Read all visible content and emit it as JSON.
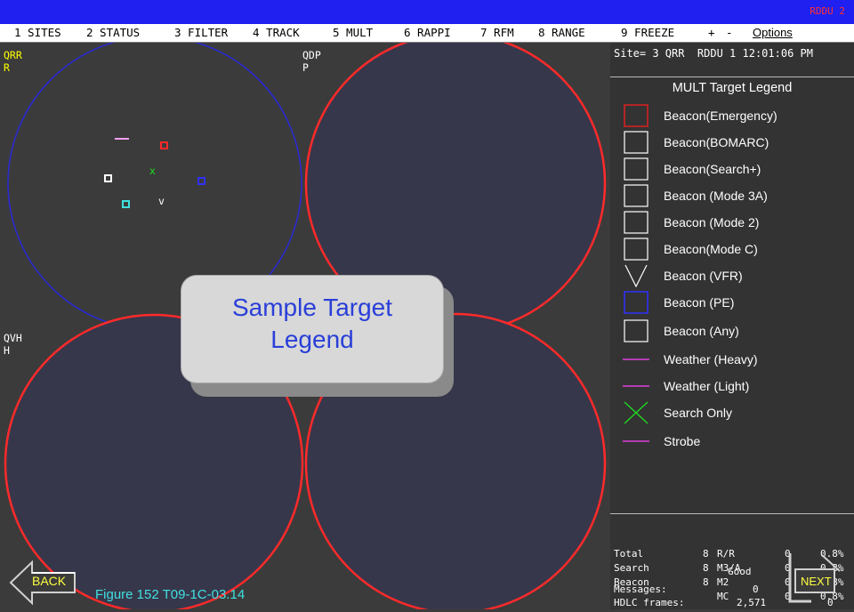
{
  "topbar": {
    "rddu": "RDDU  2"
  },
  "menu": {
    "items": [
      "1 SITES",
      "2 STATUS",
      "3 FILTER",
      "4 TRACK",
      "5 MULT",
      "6 RAPPI",
      "7 RFM",
      "8 RANGE",
      "9 FREEZE",
      "+",
      "-"
    ],
    "options_label": "Options"
  },
  "sites": {
    "qrr": {
      "name": "QRR",
      "sub": "R"
    },
    "qdp": {
      "name": "QDP",
      "sub": "P"
    },
    "qvh": {
      "name": "QVH",
      "sub": "H"
    }
  },
  "targets": {
    "x_mark": "x",
    "v_mark": "v"
  },
  "header": {
    "site_line": "Site= 3 QRR  RDDU 1 12:01:06 PM"
  },
  "legend": {
    "title": "MULT Target Legend",
    "items": [
      {
        "label": "Beacon(Emergency)",
        "color": "#e02020"
      },
      {
        "label": "Beacon(BOMARC)",
        "color": "#ffffff"
      },
      {
        "label": "Beacon(Search+)",
        "color": "#ffffff"
      },
      {
        "label": "Beacon (Mode 3A)",
        "color": "#ffffff"
      },
      {
        "label": "Beacon (Mode 2)",
        "color": "#ffffff"
      },
      {
        "label": "Beacon(Mode C)",
        "color": "#ffffff"
      },
      {
        "label": "Beacon (VFR)",
        "color": "#ffffff"
      },
      {
        "label": "Beacon (PE)",
        "color": "#3030ff"
      },
      {
        "label": "Beacon (Any)",
        "color": "#ffffff"
      },
      {
        "label": "Weather (Heavy)",
        "color": "#e040e0"
      },
      {
        "label": "Weather (Light)",
        "color": "#e040e0"
      },
      {
        "label": "Search Only",
        "color": "#20e020"
      },
      {
        "label": "Strobe",
        "color": "#e040e0"
      }
    ]
  },
  "stats": {
    "rows": [
      {
        "k": "Total",
        "n": "8",
        "m": "R/R",
        "c": "0",
        "p": "0.8%"
      },
      {
        "k": "Search",
        "n": "8",
        "m": "M3/A",
        "c": "0",
        "p": "0.8%"
      },
      {
        "k": "Beacon",
        "n": "8",
        "m": "M2",
        "c": "0",
        "p": "0.8%"
      },
      {
        "k": "",
        "n": "",
        "m": "MC",
        "c": "0",
        "p": "0.8%"
      }
    ],
    "good": "Good",
    "messages_label": "Messages:",
    "messages_value": "0",
    "hdlc_label": "HDLC frames:",
    "hdlc_value": "2,571",
    "extra_value": "0"
  },
  "popup": {
    "line1": "Sample Target",
    "line2": "Legend"
  },
  "nav": {
    "back": "BACK",
    "next": "NEXT"
  },
  "caption": "Figure 152 T09-1C-03.14",
  "colors": {
    "red": "#ff2a2a",
    "blue": "#2a2ad8",
    "cyan": "#40e0e0",
    "yellow": "#ffff00"
  }
}
